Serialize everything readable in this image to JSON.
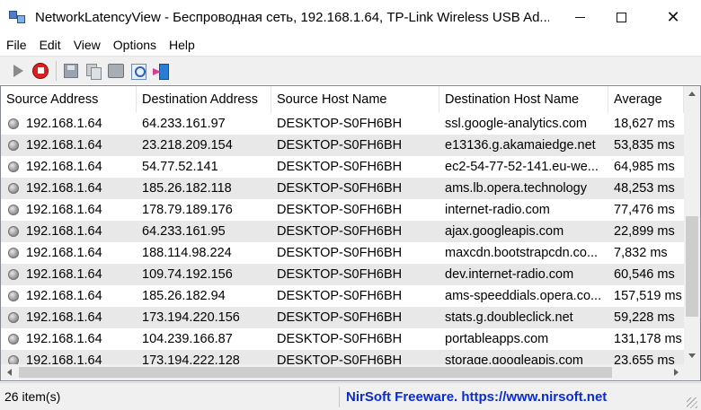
{
  "window": {
    "title": "NetworkLatencyView  -  Беспроводная сеть, 192.168.1.64, TP-Link Wireless USB Ad..."
  },
  "menu": [
    {
      "label": "File"
    },
    {
      "label": "Edit"
    },
    {
      "label": "View"
    },
    {
      "label": "Options"
    },
    {
      "label": "Help"
    }
  ],
  "toolbar": {
    "icons": [
      "play-icon",
      "stop-icon",
      "save-icon",
      "copy-icon",
      "properties-icon",
      "find-icon",
      "exit-icon"
    ]
  },
  "table": {
    "columns": [
      "Source Address",
      "Destination Address",
      "Source Host Name",
      "Destination Host Name",
      "Average"
    ],
    "rows": [
      [
        "192.168.1.64",
        "64.233.161.97",
        "DESKTOP-S0FH6BH",
        "ssl.google-analytics.com",
        "18,627 ms"
      ],
      [
        "192.168.1.64",
        "23.218.209.154",
        "DESKTOP-S0FH6BH",
        "e13136.g.akamaiedge.net",
        "53,835 ms"
      ],
      [
        "192.168.1.64",
        "54.77.52.141",
        "DESKTOP-S0FH6BH",
        "ec2-54-77-52-141.eu-we...",
        "64,985 ms"
      ],
      [
        "192.168.1.64",
        "185.26.182.118",
        "DESKTOP-S0FH6BH",
        "ams.lb.opera.technology",
        "48,253 ms"
      ],
      [
        "192.168.1.64",
        "178.79.189.176",
        "DESKTOP-S0FH6BH",
        "internet-radio.com",
        "77,476 ms"
      ],
      [
        "192.168.1.64",
        "64.233.161.95",
        "DESKTOP-S0FH6BH",
        "ajax.googleapis.com",
        "22,899 ms"
      ],
      [
        "192.168.1.64",
        "188.114.98.224",
        "DESKTOP-S0FH6BH",
        "maxcdn.bootstrapcdn.co...",
        "7,832 ms"
      ],
      [
        "192.168.1.64",
        "109.74.192.156",
        "DESKTOP-S0FH6BH",
        "dev.internet-radio.com",
        "60,546 ms"
      ],
      [
        "192.168.1.64",
        "185.26.182.94",
        "DESKTOP-S0FH6BH",
        "ams-speeddials.opera.co...",
        "157,519 ms"
      ],
      [
        "192.168.1.64",
        "173.194.220.156",
        "DESKTOP-S0FH6BH",
        "stats.g.doubleclick.net",
        "59,228 ms"
      ],
      [
        "192.168.1.64",
        "104.239.166.87",
        "DESKTOP-S0FH6BH",
        "portableapps.com",
        "131,178 ms"
      ],
      [
        "192.168.1.64",
        "173.194.222.128",
        "DESKTOP-S0FH6BH",
        "storage.googleapis.com",
        "23,655 ms"
      ]
    ]
  },
  "status": {
    "count": "26 item(s)",
    "link": "NirSoft Freeware.  https://www.nirsoft.net"
  }
}
